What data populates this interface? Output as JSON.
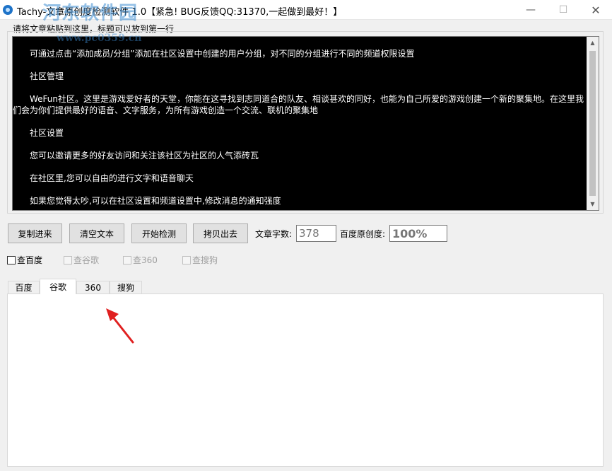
{
  "window": {
    "title": "Tachy-文章原创度检测软件 1.0【紧急! BUG反馈QQ:31370,一起做到最好！】",
    "watermark": "河东软件园",
    "watermark_url": "www.pc0359.cn",
    "minimize_glyph": "—",
    "maximize_glyph": "☐",
    "close_glyph": "✕"
  },
  "hint_label": "请将文章粘贴到这里，标题可以放到第一行",
  "text_area": {
    "lines": [
      "可通过点击“添加成员/分组”添加在社区设置中创建的用户分组，对不同的分组进行不同的频道权限设置",
      "社区管理",
      "WeFun社区。这里是游戏爱好者的天堂，你能在这寻找到志同道合的队友、相谈甚欢的同好，也能为自己所爱的游戏创建一个新的聚集地。在这里我们会为你们提供最好的语音、文字服务，为所有游戏创造一个交流、联机的聚集地",
      "社区设置",
      "您可以邀请更多的好友访问和关注该社区为社区的人气添砖瓦",
      "在社区里,您可以自由的进行文字和语音聊天",
      "如果您觉得太吵,可以在社区设置和频道设置中,修改消息的通知强度"
    ]
  },
  "toolbar": {
    "copy_in": "复制进来",
    "clear": "清空文本",
    "start": "开始检测",
    "copy_out": "拷贝出去",
    "count_label": "文章字数:",
    "count_value": "378",
    "originality_label": "百度原创度:",
    "originality_value": "100%"
  },
  "checks": {
    "baidu": "查百度",
    "google": "查谷歌",
    "s360": "查360",
    "sogou": "查搜狗"
  },
  "tabs": {
    "baidu": "百度",
    "google": "谷歌",
    "s360": "360",
    "sogou": "搜狗"
  },
  "colors": {
    "annotation_arrow": "#e02020",
    "text_area_bg": "#000000",
    "text_area_fg": "#ffffff"
  }
}
